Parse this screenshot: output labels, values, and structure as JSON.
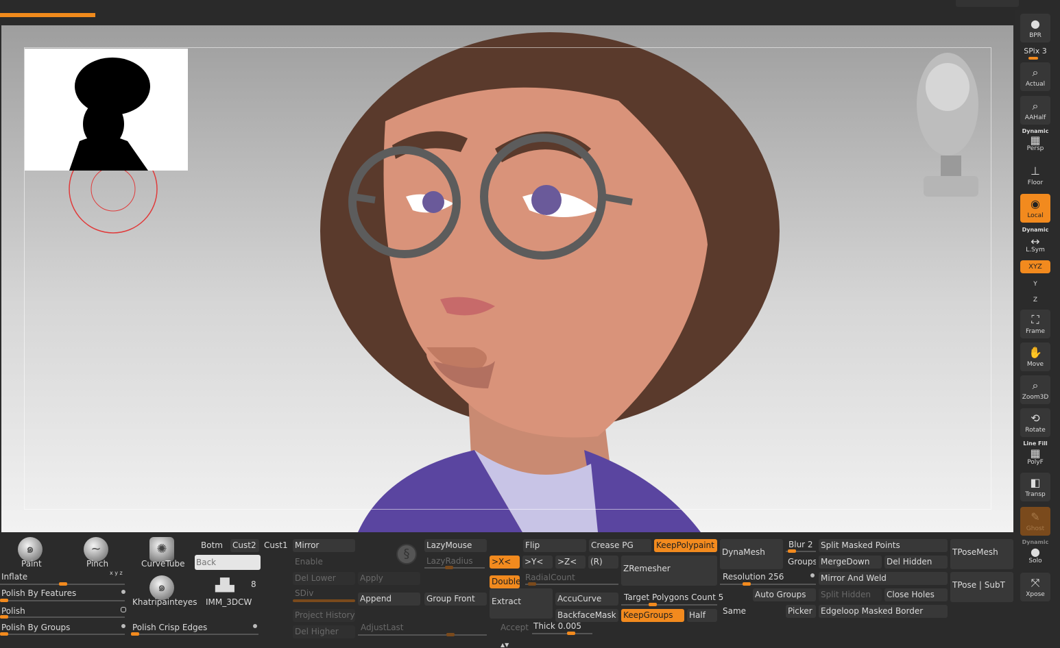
{
  "colors": {
    "accent": "#f28a1e",
    "panel": "#2b2b2b",
    "button": "#383838",
    "hair": "#5a3a2c",
    "skin": "#d9937a",
    "jacket": "#5a45a0"
  },
  "progress": {
    "fraction": 0.09
  },
  "shelf": {
    "bpr": "BPR",
    "spix": "SPix 3",
    "actual": "Actual",
    "aahalf": "AAHalf",
    "dynamic1": "Dynamic",
    "persp": "Persp",
    "floor": "Floor",
    "local": "Local",
    "dynamic2": "Dynamic",
    "lsym": "L.Sym",
    "xyz": "XYZ",
    "y": "Y",
    "z": "Z",
    "frame": "Frame",
    "move": "Move",
    "zoom3d": "Zoom3D",
    "rotate": "Rotate",
    "linefill": "Line Fill",
    "polyf": "PolyF",
    "transp": "Transp",
    "ghost": "Ghost",
    "dynamic3": "Dynamic",
    "solo": "Solo",
    "xpose": "Xpose"
  },
  "brushes": {
    "paint": "Paint",
    "pinch": "Pinch",
    "curvetube": "CurveTube",
    "khatri": "Khatripainteyes",
    "imm": "IMM_3DCW",
    "imm_count": "8"
  },
  "deformers": {
    "inflate": "Inflate",
    "xyz": "x y z",
    "polish_features": "Polish By Features",
    "polish": "Polish",
    "polish_groups": "Polish By Groups",
    "polish_crisp": "Polish Crisp Edges"
  },
  "views": {
    "botm": "Botm",
    "cust2": "Cust2",
    "cust1": "Cust1",
    "back_placeholder": "Back"
  },
  "subtool": {
    "mirror": "Mirror",
    "enable": "Enable",
    "del_lower": "Del Lower",
    "apply": "Apply",
    "sdiv": "SDiv",
    "append": "Append",
    "group_front": "Group Front",
    "project_history": "Project History",
    "del_higher": "Del Higher",
    "adjust_last": "AdjustLast",
    "lazymouse": "LazyMouse",
    "lazyradius": "LazyRadius"
  },
  "geometry": {
    "flip": "Flip",
    "crease_pg": "Crease PG",
    "keep_polypaint": "KeepPolypaint",
    "x": ">X<",
    "y": ">Y<",
    "z": ">Z<",
    "r": "(R)",
    "zremesher": "ZRemesher",
    "double": "Double",
    "radialcount": "RadialCount",
    "extract": "Extract",
    "accucurve": "AccuCurve",
    "target_polys": "Target Polygons Count 5",
    "backfacemask": "BackfaceMask",
    "keepgroups": "KeepGroups",
    "half": "Half",
    "accept": "Accept",
    "thick": "Thick 0.005"
  },
  "dynamesh": {
    "dynamesh": "DynaMesh",
    "resolution": "Resolution 256",
    "same": "Same",
    "auto_groups": "Auto Groups",
    "picker": "Picker",
    "blur": "Blur 2",
    "groups": "Groups"
  },
  "tools": {
    "split_masked": "Split Masked Points",
    "mergedown": "MergeDown",
    "del_hidden": "Del Hidden",
    "mirror_weld": "Mirror And Weld",
    "split_hidden": "Split Hidden",
    "close_holes": "Close Holes",
    "edgeloop": "Edgeloop Masked Border",
    "tposemesh": "TPoseMesh",
    "tpose_subt": "TPose | SubT"
  }
}
